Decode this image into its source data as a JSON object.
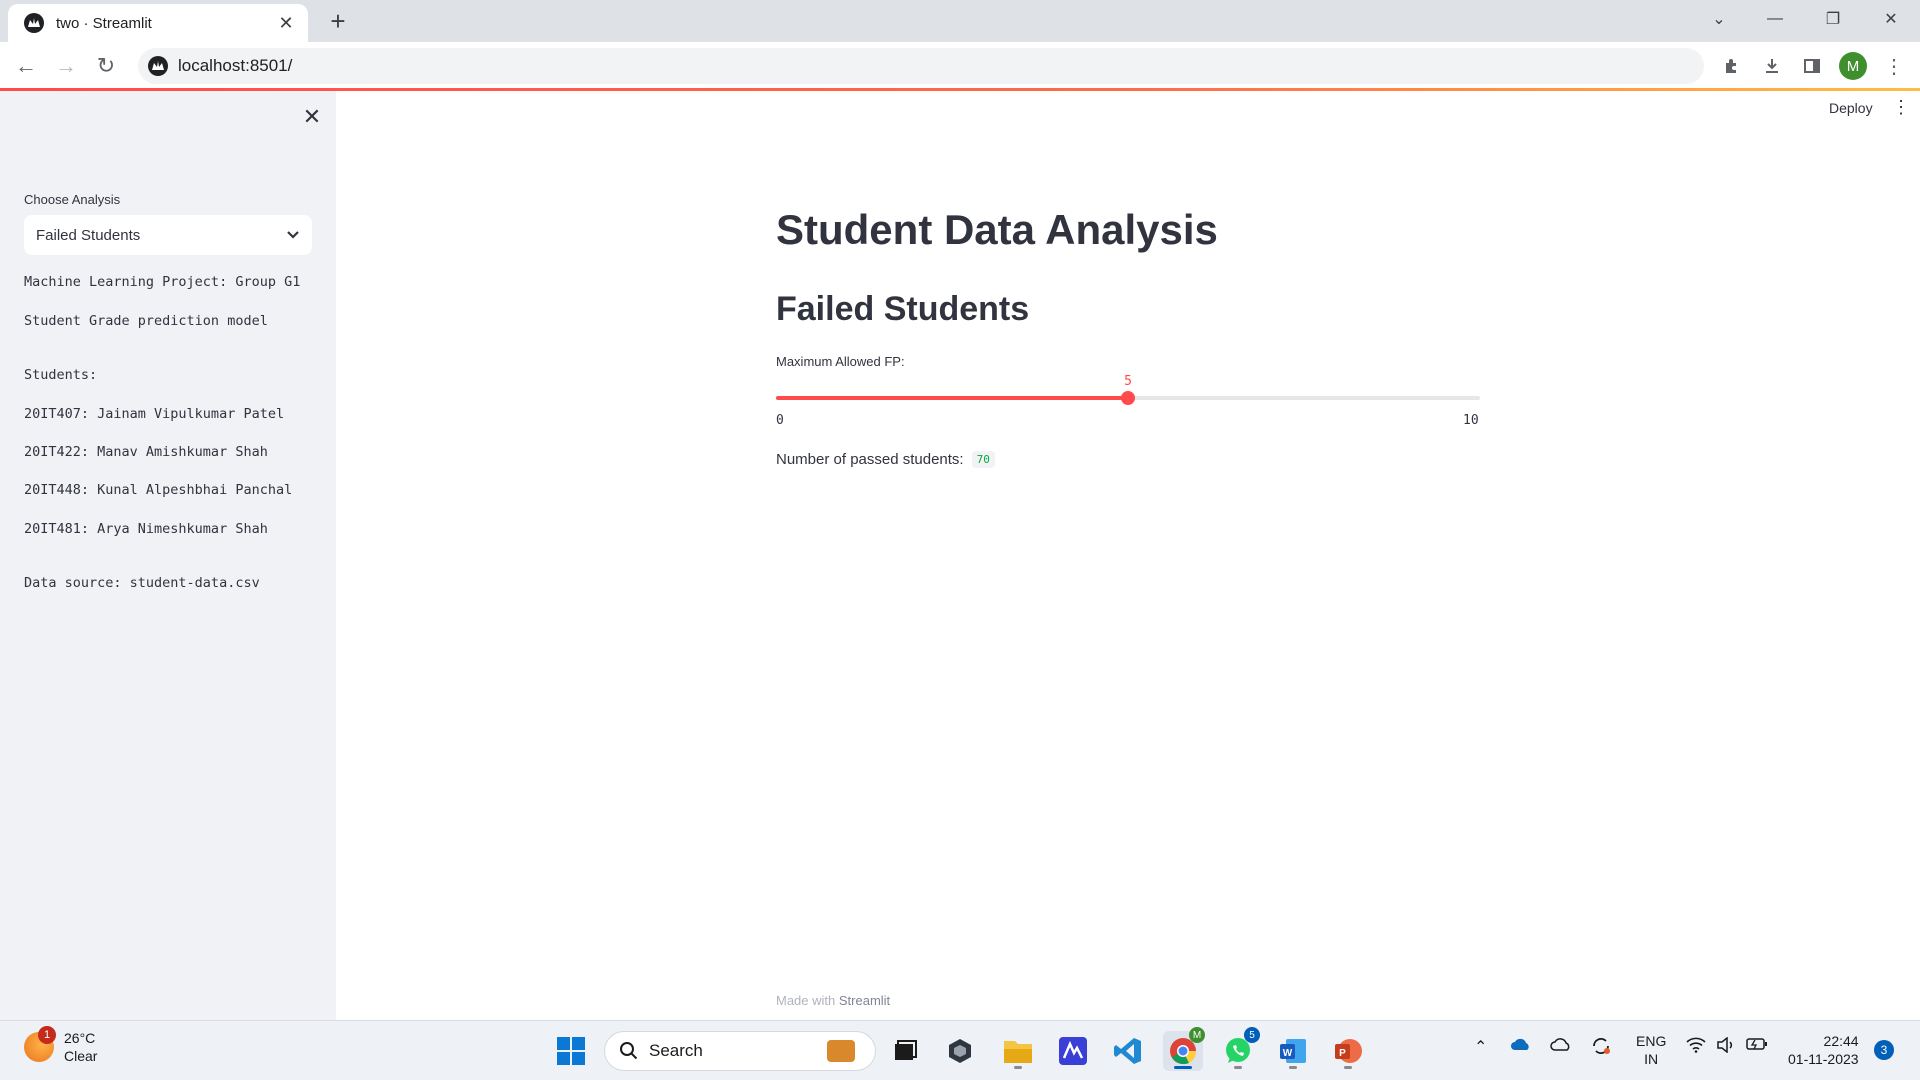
{
  "browser": {
    "tab_title": "two · Streamlit",
    "url": "localhost:8501/",
    "profile_initial": "M",
    "accent": "#ff4b4b"
  },
  "app": {
    "header": {
      "deploy_label": "Deploy"
    },
    "sidebar": {
      "select_label": "Choose Analysis",
      "select_value": "Failed Students",
      "project": "Machine Learning Project: Group G1",
      "model": "Student Grade prediction model",
      "students_heading": "Students:",
      "students": [
        "20IT407: Jainam Vipulkumar Patel",
        "20IT422: Manav Amishkumar Shah",
        "20IT448: Kunal Alpeshbhai Panchal",
        "20IT481: Arya Nimeshkumar Shah"
      ],
      "data_source": "Data source: student-data.csv"
    },
    "main": {
      "title": "Student Data Analysis",
      "subheader": "Failed Students",
      "slider": {
        "label": "Maximum Allowed FP:",
        "value": 5,
        "min": 0,
        "max": 10
      },
      "result_label": "Number of passed students:",
      "result_value": "70"
    },
    "footer": {
      "prefix": "Made with",
      "brand": "Streamlit"
    }
  },
  "taskbar": {
    "weather_temp": "26°C",
    "weather_desc": "Clear",
    "weather_badge": "1",
    "search_label": "Search",
    "whatsapp_badge": "5",
    "lang_line1": "ENG",
    "lang_line2": "IN",
    "time": "22:44",
    "date": "01-11-2023",
    "notifications": "3",
    "chrome_badge": "M"
  }
}
